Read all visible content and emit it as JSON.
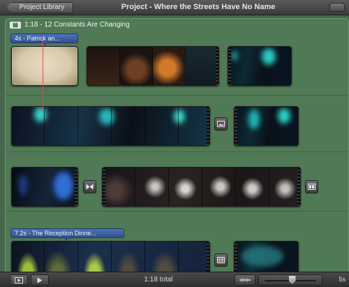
{
  "toolbar": {
    "back_label": "Project Library",
    "title": "Project - Where the Streets Have No Name"
  },
  "project": {
    "header": "1:18 - 12 Constants Are Changing",
    "header_icon": "project-filmstrip-icon"
  },
  "titles": [
    {
      "label": "4s - Patrick an..."
    },
    {
      "label": "7.2s - The Reception Dinne..."
    }
  ],
  "transitions": [
    {
      "icon": "picture-transition-icon"
    },
    {
      "icon": "cross-dissolve-icon"
    },
    {
      "icon": "split-screen-icon"
    },
    {
      "icon": "grid-transition-icon"
    }
  ],
  "bottom": {
    "total": "1:18 total",
    "zoom_value": "5s",
    "zoom_level": 0.52
  },
  "colors": {
    "canvas": "#507956",
    "title_bubble": "#3c5fa3",
    "playhead": "#e84848"
  }
}
